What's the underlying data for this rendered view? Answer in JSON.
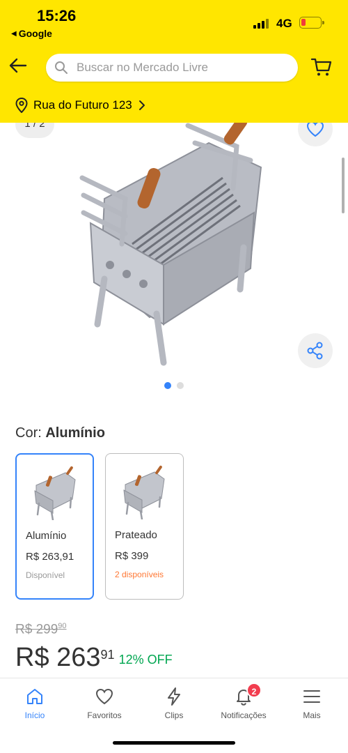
{
  "status_bar": {
    "time": "15:26",
    "back_app": "Google",
    "network": "4G",
    "battery_percent": 10
  },
  "header": {
    "search_placeholder": "Buscar no Mercado Livre",
    "address": "Rua do Futuro 123"
  },
  "gallery": {
    "counter": "1 / 2",
    "current_index": 1,
    "total": 2
  },
  "color": {
    "label": "Cor:",
    "selected": "Alumínio",
    "options": [
      {
        "name": "Alumínio",
        "price": "R$ 263,91",
        "stock": "Disponível",
        "selected": true
      },
      {
        "name": "Prateado",
        "price": "R$ 399",
        "stock": "2 disponíveis",
        "selected": false
      }
    ]
  },
  "price": {
    "old_main": "R$ 299",
    "old_cents": "90",
    "new_main": "R$ 263",
    "new_cents": "91",
    "discount": "12% OFF"
  },
  "bottom_nav": {
    "items": [
      {
        "label": "Início",
        "icon": "home-icon",
        "active": true
      },
      {
        "label": "Favoritos",
        "icon": "heart-icon",
        "active": false
      },
      {
        "label": "Clips",
        "icon": "bolt-icon",
        "active": false
      },
      {
        "label": "Notificações",
        "icon": "bell-icon",
        "active": false,
        "badge": "2"
      },
      {
        "label": "Mais",
        "icon": "menu-icon",
        "active": false
      }
    ]
  },
  "colors": {
    "brand_yellow": "#FFE600",
    "accent_blue": "#3483FA",
    "discount_green": "#00a650",
    "badge_red": "#f23d4f",
    "stock_orange": "#ff7733"
  }
}
